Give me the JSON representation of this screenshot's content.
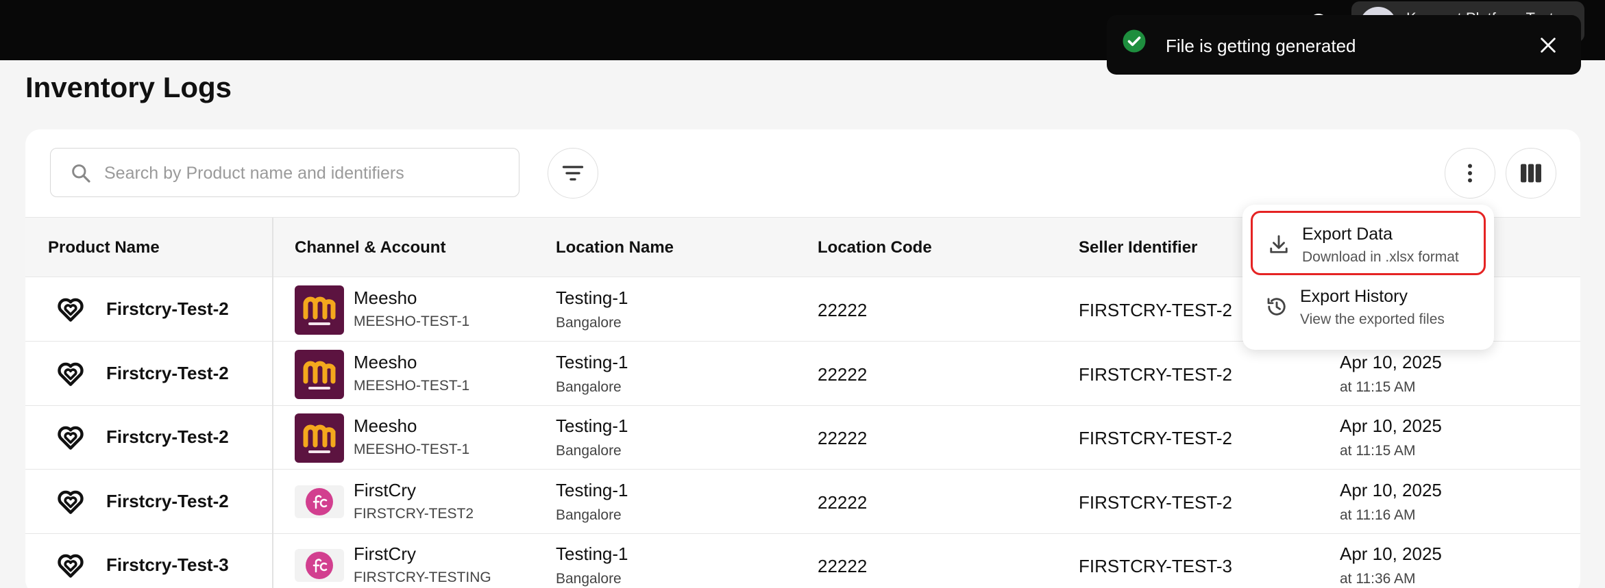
{
  "header": {
    "account_name": "Konnect Platform Test"
  },
  "page": {
    "title": "Inventory Logs"
  },
  "search": {
    "placeholder": "Search by Product name and identifiers",
    "value": ""
  },
  "table": {
    "columns": [
      "Product Name",
      "Channel & Account",
      "Location Name",
      "Location Code",
      "Seller Identifier"
    ],
    "rows": [
      {
        "product": "Firstcry-Test-2",
        "channel": "Meesho",
        "channel_logo": "meesho",
        "account": "MEESHO-TEST-1",
        "location": "Testing-1",
        "city": "Bangalore",
        "code": "22222",
        "seller": "FIRSTCRY-TEST-2",
        "date": "",
        "time": ""
      },
      {
        "product": "Firstcry-Test-2",
        "channel": "Meesho",
        "channel_logo": "meesho",
        "account": "MEESHO-TEST-1",
        "location": "Testing-1",
        "city": "Bangalore",
        "code": "22222",
        "seller": "FIRSTCRY-TEST-2",
        "date": "Apr 10, 2025",
        "time": "at 11:15 AM"
      },
      {
        "product": "Firstcry-Test-2",
        "channel": "Meesho",
        "channel_logo": "meesho",
        "account": "MEESHO-TEST-1",
        "location": "Testing-1",
        "city": "Bangalore",
        "code": "22222",
        "seller": "FIRSTCRY-TEST-2",
        "date": "Apr 10, 2025",
        "time": "at 11:15 AM"
      },
      {
        "product": "Firstcry-Test-2",
        "channel": "FirstCry",
        "channel_logo": "firstcry",
        "account": "FIRSTCRY-TEST2",
        "location": "Testing-1",
        "city": "Bangalore",
        "code": "22222",
        "seller": "FIRSTCRY-TEST-2",
        "date": "Apr 10, 2025",
        "time": "at 11:16 AM"
      },
      {
        "product": "Firstcry-Test-3",
        "channel": "FirstCry",
        "channel_logo": "firstcry",
        "account": "FIRSTCRY-TESTING",
        "location": "Testing-1",
        "city": "Bangalore",
        "code": "22222",
        "seller": "FIRSTCRY-TEST-3",
        "date": "Apr 10, 2025",
        "time": "at 11:36 AM"
      }
    ]
  },
  "menu": {
    "items": [
      {
        "title": "Export Data",
        "subtitle": "Download in .xlsx format",
        "icon": "download-icon"
      },
      {
        "title": "Export History",
        "subtitle": "View the exported files",
        "icon": "history-icon"
      }
    ]
  },
  "toast": {
    "message": "File is getting generated",
    "icon": "check-circle-icon",
    "accent": "#1e8e3e"
  },
  "colors": {
    "meesho_brand": "#5c1340",
    "meesho_letter": "#f4a81d",
    "firstcry_brand": "#d23f8f",
    "highlight_border": "#e52323"
  }
}
